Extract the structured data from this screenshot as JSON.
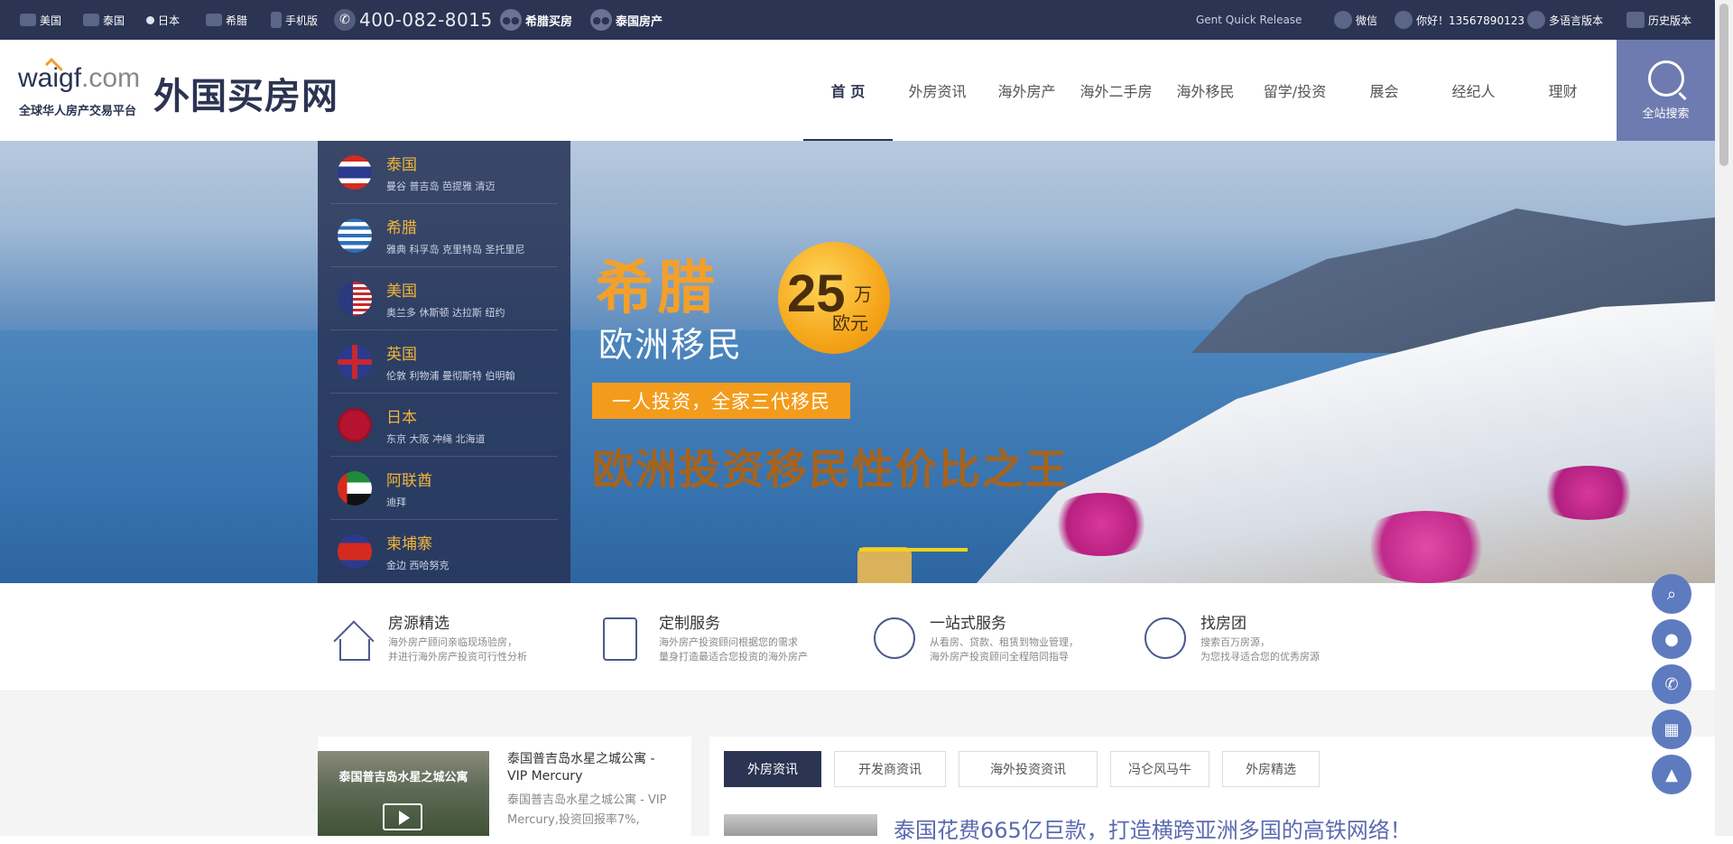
{
  "topbar": {
    "countries": [
      "美国",
      "泰国",
      "日本",
      "希腊"
    ],
    "mobile": "手机版",
    "phone": "400-082-8015",
    "links": [
      "希腊买房",
      "泰国房产"
    ],
    "release": "Gent Quick Release",
    "wechat": "微信",
    "greeting": "你好！13567890123",
    "language": "多语言版本",
    "history": "历史版本"
  },
  "logo": {
    "en_main": "waigf",
    "en_suffix": ".com",
    "slogan": "全球华人房产交易平台",
    "cn": "外国买房网"
  },
  "nav": {
    "items": [
      "首 页",
      "外房资讯",
      "海外房产",
      "海外二手房",
      "海外移民",
      "留学/投资",
      "展会",
      "经纪人",
      "理财"
    ],
    "active_index": 0,
    "search_label": "全站搜索"
  },
  "countries": [
    {
      "name": "泰国",
      "cities": "曼谷  普吉岛  芭提雅  清迈",
      "flag": "thailand"
    },
    {
      "name": "希腊",
      "cities": "雅典  科孚岛  克里特岛  圣托里尼",
      "flag": "greece"
    },
    {
      "name": "美国",
      "cities": "奥兰多  休斯顿  达拉斯  纽约",
      "flag": "usa"
    },
    {
      "name": "英国",
      "cities": "伦敦  利物浦  曼彻斯特  伯明翰",
      "flag": "uk"
    },
    {
      "name": "日本",
      "cities": "东京  大阪  冲绳  北海道",
      "flag": "japan"
    },
    {
      "name": "阿联酋",
      "cities": "迪拜",
      "flag": "uae"
    },
    {
      "name": "柬埔寨",
      "cities": "金边  西哈努克",
      "flag": "cambodia"
    }
  ],
  "banner": {
    "title": "希腊",
    "subtitle": "欧洲移民",
    "badge_amount": "25",
    "badge_unit": "万",
    "badge_currency": "欧元",
    "tag": "一人投资，全家三代移民",
    "slogan": "欧洲投资移民性价比之王"
  },
  "features": [
    {
      "title": "房源精选",
      "desc1": "海外房产顾问亲临现场验房，",
      "desc2": "并进行海外房产投资可行性分析",
      "icon": "house-icon"
    },
    {
      "title": "定制服务",
      "desc1": "海外房产投资顾问根据您的需求",
      "desc2": "量身打造最适合您投资的海外房产",
      "icon": "document-icon"
    },
    {
      "title": "一站式服务",
      "desc1": "从看房、贷款、租赁到物业管理，",
      "desc2": "海外房产投资顾问全程陪同指导",
      "icon": "headset-icon"
    },
    {
      "title": "找房团",
      "desc1": "搜索百万房源，",
      "desc2": "为您找寻适合您的优秀房源",
      "icon": "search-icon"
    }
  ],
  "news_left": {
    "thumb_caption": "泰国普吉岛水星之城公寓",
    "title": "泰国普吉岛水星之城公寓 - VIP Mercury",
    "summary": "泰国普吉岛水星之城公寓 - VIP Mercury,投资回报率7%,"
  },
  "news_right": {
    "tabs": [
      "外房资讯",
      "开发商资讯",
      "海外投资资讯",
      "冯仑风马牛",
      "外房精选"
    ],
    "active_tab": 0,
    "headline": "泰国花费665亿巨款，打造横跨亚洲多国的高铁网络！"
  },
  "float_buttons": [
    "search-icon",
    "chat-icon",
    "phone-icon",
    "qrcode-icon",
    "rocket-icon"
  ],
  "colors": {
    "primary": "#2b3452",
    "accent": "#f39c1b",
    "search_bg": "#6d7bb0",
    "float": "#5e7bbf"
  }
}
